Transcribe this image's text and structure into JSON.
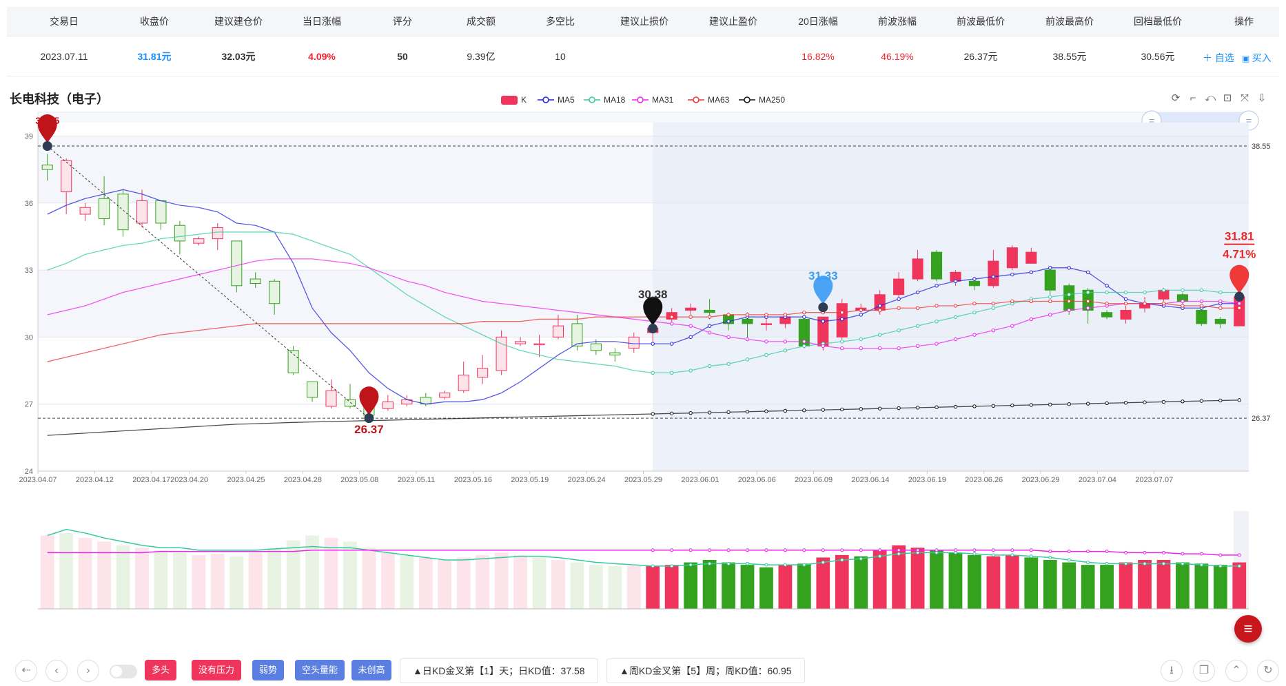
{
  "table": {
    "headers": [
      "交易日",
      "收盘价",
      "建议建仓价",
      "当日涨幅",
      "评分",
      "成交额",
      "多空比",
      "建议止损价",
      "建议止盈价",
      "20日涨幅",
      "前波涨幅",
      "前波最低价",
      "前波最高价",
      "回档最低价",
      "操作"
    ],
    "row": [
      "2023.07.11",
      "31.81元",
      "32.03元",
      "4.09%",
      "50",
      "9.39亿",
      "10",
      "",
      "",
      "16.82%",
      "46.19%",
      "26.37元",
      "38.55元",
      "30.56元"
    ],
    "actions": {
      "watch": "＋ 自选",
      "buy": "买入"
    }
  },
  "stock_title": "长电科技（电子）",
  "colors": {
    "up": "#f0355c",
    "down": "#35a21f",
    "ma5": "#2222dd",
    "ma18": "#36c9a0",
    "ma31": "#ee22ee",
    "ma63": "#ee3333",
    "ma250": "#111111",
    "accent": "#c8161d",
    "blue": "#1890ff"
  },
  "chart_data": [
    {
      "type": "candlestick",
      "title": "长电科技（电子）",
      "legend": [
        "K",
        "MA5",
        "MA18",
        "MA31",
        "MA63",
        "MA250"
      ],
      "x_ticks": [
        "2023.04.07",
        "2023.04.12",
        "2023.04.17",
        "2023.04.20",
        "2023.04.25",
        "2023.04.28",
        "2023.05.08",
        "2023.05.11",
        "2023.05.16",
        "2023.05.19",
        "2023.05.24",
        "2023.05.29",
        "2023.06.01",
        "2023.06.06",
        "2023.06.09",
        "2023.06.14",
        "2023.06.19",
        "2023.06.26",
        "2023.06.29",
        "2023.07.04",
        "2023.07.07"
      ],
      "y_ticks": [
        "24",
        "27",
        "30",
        "33",
        "36",
        "39"
      ],
      "ylim": [
        24,
        39.6
      ],
      "ref_lines": [
        {
          "value": 38.55,
          "label": "38.55"
        },
        {
          "value": 26.37,
          "label": "26.37"
        }
      ],
      "candles": [
        [
          37.7,
          37.5,
          38.2,
          37.0
        ],
        [
          36.5,
          37.9,
          38.0,
          35.5
        ],
        [
          35.5,
          35.8,
          36.0,
          35.2
        ],
        [
          36.2,
          35.3,
          37.2,
          35.0
        ],
        [
          36.4,
          34.8,
          36.6,
          34.5
        ],
        [
          35.1,
          36.1,
          36.6,
          34.9
        ],
        [
          36.1,
          35.1,
          36.1,
          34.8
        ],
        [
          35.0,
          34.3,
          35.2,
          33.7
        ],
        [
          34.2,
          34.4,
          34.5,
          34.1
        ],
        [
          34.4,
          34.9,
          35.1,
          33.9
        ],
        [
          34.3,
          32.3,
          34.3,
          32.0
        ],
        [
          32.6,
          32.4,
          32.9,
          32.2
        ],
        [
          32.5,
          31.5,
          32.6,
          31.0
        ],
        [
          29.4,
          28.4,
          29.6,
          28.3
        ],
        [
          28.0,
          27.3,
          28.0,
          27.1
        ],
        [
          26.9,
          27.6,
          28.1,
          26.8
        ],
        [
          27.2,
          26.9,
          27.9,
          26.8
        ],
        [
          27.2,
          26.5,
          27.7,
          26.4
        ],
        [
          26.8,
          27.1,
          27.4,
          26.7
        ],
        [
          27.0,
          27.2,
          27.4,
          26.9
        ],
        [
          27.3,
          27.0,
          27.5,
          26.9
        ],
        [
          27.3,
          27.5,
          27.6,
          27.2
        ],
        [
          27.6,
          28.3,
          28.9,
          27.5
        ],
        [
          28.2,
          28.6,
          29.2,
          27.9
        ],
        [
          28.5,
          30.0,
          30.3,
          28.3
        ],
        [
          29.7,
          29.8,
          30.0,
          29.6
        ],
        [
          29.7,
          29.7,
          30.1,
          29.1
        ],
        [
          30.0,
          30.5,
          31.0,
          29.9
        ],
        [
          30.6,
          29.6,
          31.0,
          29.4
        ],
        [
          29.7,
          29.4,
          29.9,
          29.2
        ],
        [
          29.3,
          29.2,
          29.5,
          28.9
        ],
        [
          29.5,
          30.0,
          30.2,
          29.3
        ],
        [
          30.2,
          30.4,
          30.6,
          29.8
        ],
        [
          30.8,
          31.1,
          31.3,
          30.6
        ],
        [
          31.2,
          31.3,
          31.5,
          31.0
        ],
        [
          31.2,
          31.1,
          31.7,
          30.8
        ],
        [
          31.0,
          30.6,
          31.1,
          30.3
        ],
        [
          30.8,
          30.6,
          31.1,
          29.9
        ],
        [
          30.6,
          30.6,
          31.0,
          30.3
        ],
        [
          30.6,
          30.9,
          31.0,
          30.4
        ],
        [
          30.8,
          29.6,
          30.8,
          29.5
        ],
        [
          29.6,
          30.9,
          30.9,
          29.4
        ],
        [
          30.0,
          31.5,
          31.7,
          29.9
        ],
        [
          31.2,
          31.3,
          31.5,
          31.1
        ],
        [
          31.2,
          31.9,
          32.1,
          31.0
        ],
        [
          31.9,
          32.6,
          32.9,
          31.7
        ],
        [
          32.6,
          33.5,
          33.9,
          32.5
        ],
        [
          33.8,
          32.6,
          33.9,
          32.5
        ],
        [
          32.5,
          32.9,
          33.0,
          32.3
        ],
        [
          32.5,
          32.3,
          32.7,
          32.1
        ],
        [
          32.3,
          33.4,
          33.9,
          32.2
        ],
        [
          33.1,
          34.0,
          34.1,
          33.0
        ],
        [
          33.3,
          33.8,
          34.0,
          33.3
        ],
        [
          33.0,
          32.1,
          33.1,
          31.9
        ],
        [
          32.3,
          31.2,
          32.4,
          31.0
        ],
        [
          32.1,
          31.2,
          32.2,
          30.6
        ],
        [
          31.1,
          30.9,
          31.2,
          30.8
        ],
        [
          30.8,
          31.2,
          31.4,
          30.6
        ],
        [
          31.3,
          31.5,
          31.8,
          31.1
        ],
        [
          31.7,
          32.1,
          32.2,
          31.6
        ],
        [
          31.9,
          31.6,
          32.0,
          31.4
        ],
        [
          31.2,
          30.6,
          31.2,
          30.5
        ],
        [
          30.8,
          30.6,
          30.9,
          30.4
        ],
        [
          30.5,
          31.8,
          32.0,
          30.5
        ]
      ],
      "series": [
        {
          "name": "MA5",
          "values": [
            35.5,
            35.9,
            36.2,
            36.4,
            36.6,
            36.4,
            36.1,
            35.9,
            35.8,
            35.6,
            35.1,
            35.0,
            34.7,
            33.3,
            31.3,
            30.2,
            29.4,
            28.4,
            27.7,
            27.2,
            27.0,
            27.1,
            27.1,
            27.2,
            27.5,
            28.0,
            28.6,
            29.2,
            29.7,
            29.8,
            29.8,
            29.7,
            29.7,
            29.7,
            30.0,
            30.5,
            30.7,
            30.9,
            30.9,
            30.9,
            30.9,
            30.7,
            30.8,
            31.0,
            31.4,
            31.7,
            32.0,
            32.3,
            32.5,
            32.6,
            32.7,
            32.8,
            32.9,
            33.1,
            33.1,
            32.9,
            32.3,
            31.7,
            31.5,
            31.4,
            31.3,
            31.3,
            31.5,
            31.5
          ]
        },
        {
          "name": "MA18",
          "values": [
            33.0,
            33.3,
            33.7,
            33.9,
            34.1,
            34.2,
            34.4,
            34.5,
            34.6,
            34.7,
            34.7,
            34.7,
            34.7,
            34.6,
            34.3,
            34.0,
            33.7,
            33.1,
            32.5,
            31.9,
            31.4,
            30.9,
            30.5,
            30.1,
            29.7,
            29.4,
            29.2,
            29.0,
            28.9,
            28.8,
            28.7,
            28.5,
            28.4,
            28.4,
            28.5,
            28.7,
            28.8,
            29.0,
            29.2,
            29.4,
            29.6,
            29.7,
            29.8,
            29.9,
            30.1,
            30.3,
            30.5,
            30.7,
            30.9,
            31.1,
            31.3,
            31.5,
            31.7,
            31.8,
            31.9,
            32.0,
            32.0,
            32.0,
            32.0,
            32.1,
            32.1,
            32.1,
            32.0,
            32.0
          ]
        },
        {
          "name": "MA31",
          "values": [
            31.0,
            31.2,
            31.4,
            31.7,
            32.0,
            32.2,
            32.4,
            32.6,
            32.8,
            33.0,
            33.2,
            33.4,
            33.5,
            33.5,
            33.5,
            33.4,
            33.3,
            33.1,
            32.8,
            32.5,
            32.3,
            32.0,
            31.8,
            31.6,
            31.5,
            31.4,
            31.3,
            31.2,
            31.1,
            31.0,
            30.9,
            30.8,
            30.7,
            30.6,
            30.5,
            30.2,
            30.0,
            29.9,
            29.8,
            29.8,
            29.8,
            29.6,
            29.5,
            29.5,
            29.5,
            29.5,
            29.6,
            29.7,
            29.9,
            30.1,
            30.3,
            30.5,
            30.8,
            31.0,
            31.2,
            31.3,
            31.4,
            31.5,
            31.5,
            31.5,
            31.6,
            31.6,
            31.6,
            31.5
          ]
        },
        {
          "name": "MA63",
          "values": [
            28.9,
            29.1,
            29.3,
            29.5,
            29.7,
            29.9,
            30.1,
            30.2,
            30.3,
            30.4,
            30.5,
            30.6,
            30.6,
            30.6,
            30.6,
            30.6,
            30.6,
            30.6,
            30.6,
            30.6,
            30.6,
            30.6,
            30.6,
            30.7,
            30.7,
            30.7,
            30.8,
            30.8,
            30.8,
            30.9,
            30.9,
            30.9,
            30.9,
            30.9,
            30.9,
            30.9,
            31.0,
            31.0,
            31.0,
            31.0,
            31.1,
            31.1,
            31.1,
            31.2,
            31.2,
            31.3,
            31.3,
            31.4,
            31.4,
            31.5,
            31.5,
            31.6,
            31.6,
            31.6,
            31.6,
            31.6,
            31.5,
            31.5,
            31.5,
            31.5,
            31.4,
            31.4,
            31.3,
            31.3
          ]
        },
        {
          "name": "MA250",
          "values": [
            25.6,
            25.65,
            25.7,
            25.75,
            25.8,
            25.85,
            25.9,
            25.95,
            26.0,
            26.05,
            26.1,
            26.12,
            26.15,
            26.18,
            26.2,
            26.22,
            26.24,
            26.26,
            26.28,
            26.3,
            26.32,
            26.34,
            26.36,
            26.38,
            26.4,
            26.42,
            26.44,
            26.46,
            26.48,
            26.5,
            26.52,
            26.54,
            26.56,
            26.58,
            26.6,
            26.62,
            26.64,
            26.66,
            26.68,
            26.7,
            26.72,
            26.74,
            26.76,
            26.78,
            26.8,
            26.82,
            26.84,
            26.86,
            26.88,
            26.9,
            26.92,
            26.94,
            26.96,
            26.98,
            27.0,
            27.02,
            27.04,
            27.06,
            27.08,
            27.1,
            27.12,
            27.14,
            27.16,
            27.18
          ]
        }
      ],
      "annotations": [
        {
          "label": "38.55",
          "index": 0,
          "value": 38.55,
          "pin": "red"
        },
        {
          "label": "26.37",
          "index": 17,
          "value": 26.37,
          "pin": "red"
        },
        {
          "label": "30.38",
          "index": 32,
          "value": 30.38,
          "pin": "black"
        },
        {
          "label": "31.33",
          "index": 41,
          "value": 31.33,
          "pin": "blue"
        },
        {
          "label": "31.81",
          "index": 63,
          "value": 31.81,
          "pin": "red"
        },
        {
          "label": "4.71%",
          "index": 63,
          "value": 31.81,
          "pin": "none"
        }
      ]
    },
    {
      "type": "bar",
      "title": "",
      "values": [
        60,
        62,
        58,
        55,
        52,
        50,
        48,
        46,
        44,
        45,
        43,
        46,
        50,
        56,
        60,
        58,
        55,
        50,
        46,
        44,
        42,
        40,
        42,
        44,
        46,
        44,
        42,
        40,
        38,
        36,
        35,
        35,
        35,
        36,
        38,
        40,
        38,
        36,
        34,
        36,
        37,
        42,
        44,
        43,
        48,
        52,
        50,
        48,
        46,
        44,
        43,
        44,
        42,
        40,
        38,
        36,
        36,
        38,
        40,
        40,
        38,
        37,
        36,
        38
      ],
      "up": [
        true,
        false,
        true,
        true,
        false,
        true,
        false,
        false,
        true,
        true,
        false,
        true,
        false,
        false,
        false,
        true,
        false,
        true,
        true,
        false,
        true,
        true,
        true,
        true,
        true,
        true,
        false,
        true,
        false,
        false,
        false,
        true,
        true,
        true,
        false,
        false,
        false,
        false,
        false,
        true,
        false,
        true,
        true,
        false,
        true,
        true,
        true,
        false,
        false,
        false,
        true,
        true,
        false,
        false,
        false,
        false,
        false,
        true,
        true,
        true,
        false,
        false,
        false,
        true
      ],
      "series": [
        {
          "name": "vol_ma_green",
          "values": [
            60,
            65,
            62,
            58,
            55,
            52,
            50,
            50,
            48,
            48,
            48,
            48,
            49,
            50,
            51,
            50,
            50,
            48,
            46,
            44,
            42,
            40,
            40,
            41,
            42,
            43,
            43,
            42,
            40,
            38,
            37,
            36,
            35,
            35,
            36,
            37,
            37,
            37,
            36,
            36,
            36,
            38,
            40,
            41,
            43,
            45,
            46,
            46,
            46,
            45,
            44,
            44,
            43,
            42,
            40,
            38,
            37,
            37,
            37,
            37,
            37,
            36,
            35,
            35
          ]
        },
        {
          "name": "vol_ma_magenta",
          "values": [
            46,
            46,
            46,
            46,
            46,
            46,
            47,
            47,
            47,
            47,
            47,
            47,
            47,
            47,
            48,
            48,
            48,
            48,
            48,
            48,
            48,
            48,
            48,
            48,
            48,
            48,
            48,
            48,
            48,
            48,
            48,
            48,
            48,
            48,
            48,
            48,
            48,
            48,
            48,
            48,
            48,
            48,
            48,
            48,
            48,
            48,
            48,
            48,
            48,
            48,
            48,
            48,
            48,
            47,
            47,
            47,
            47,
            46,
            46,
            46,
            45,
            45,
            44,
            44
          ]
        }
      ]
    }
  ],
  "footer": {
    "tags": [
      "多头",
      "没有压力",
      "弱势",
      "空头量能",
      "未创高"
    ],
    "notes": [
      "▲日KD金叉第【1】天；日KD值：37.58",
      "▲周KD金叉第【5】周；周KD值：60.95"
    ]
  }
}
